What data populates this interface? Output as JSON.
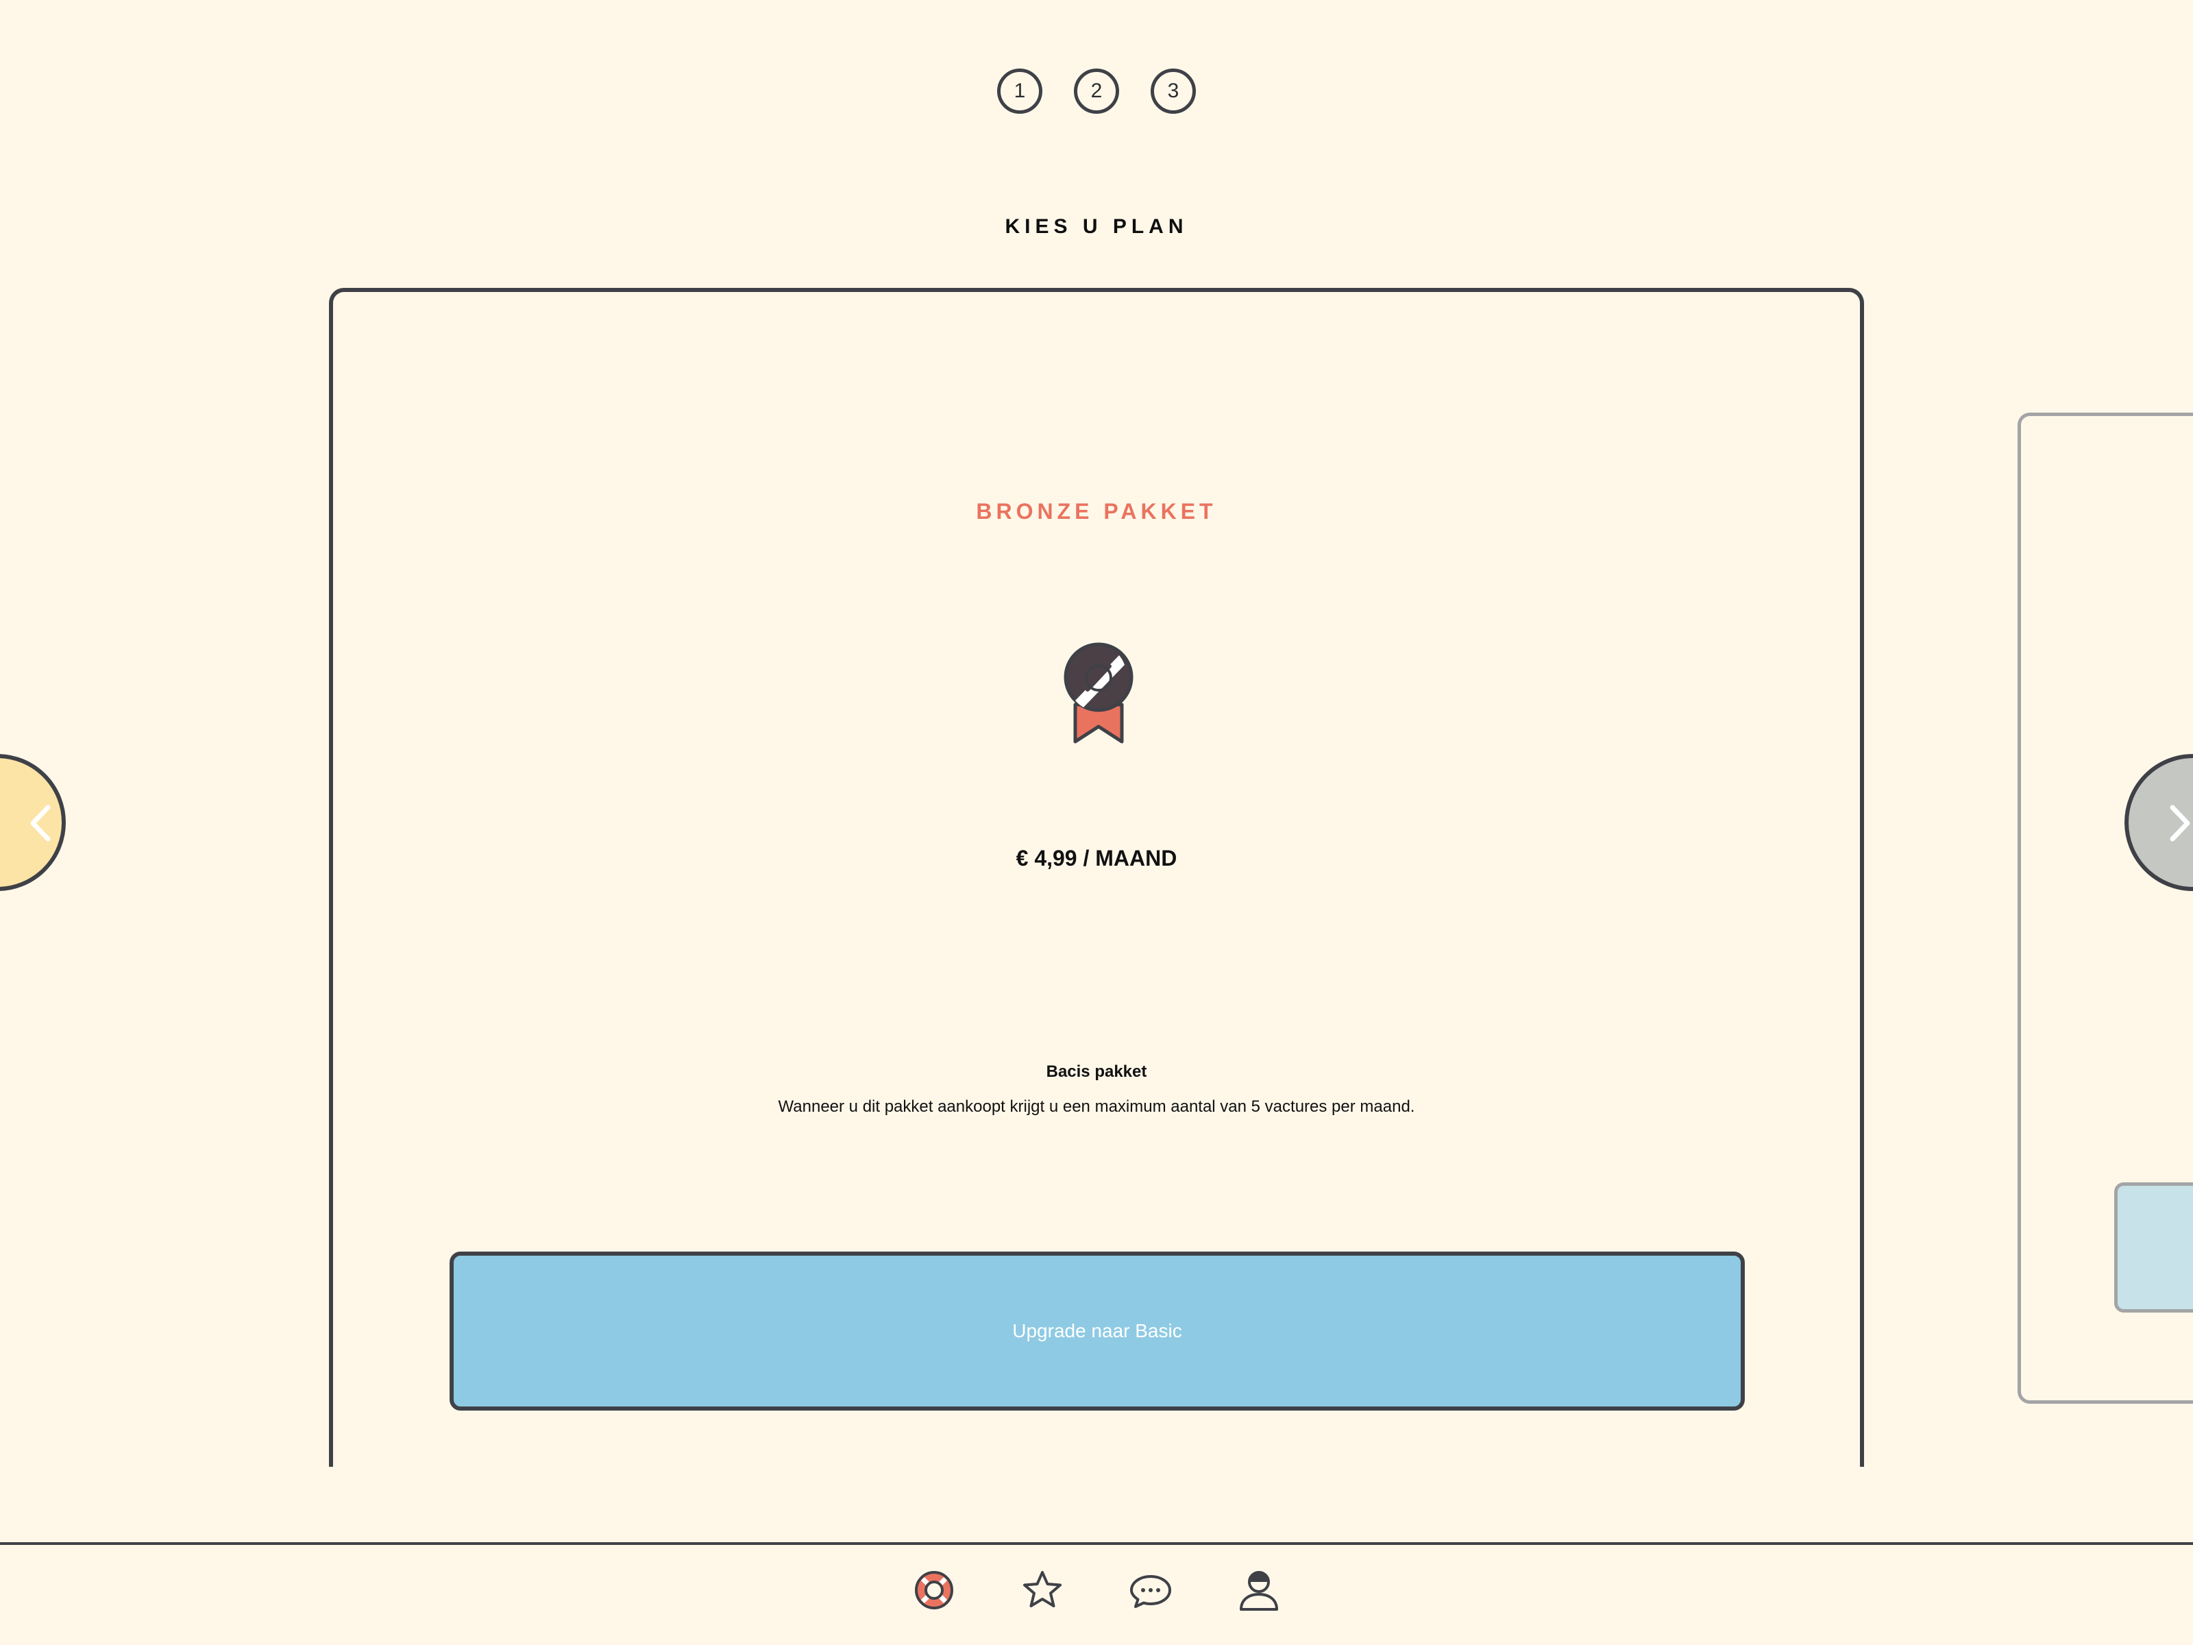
{
  "steps": [
    "1",
    "2",
    "3"
  ],
  "page_title": "KIES U PLAN",
  "plan": {
    "name": "BRONZE PAKKET",
    "icon": "medal-icon",
    "price": "€ 4,99 / MAAND",
    "desc_title": "Bacis pakket",
    "desc_text": "Wanneer u dit pakket aankoopt krijgt u een maximum aantal van 5 vactures per maand.",
    "button_label": "Upgrade naar Basic"
  },
  "navigation": {
    "prev_icon": "chevron-left-icon",
    "next_icon": "chevron-right-icon"
  },
  "bottom_nav": {
    "items": [
      "lifebuoy-icon",
      "star-icon",
      "chat-icon",
      "user-icon"
    ]
  },
  "colors": {
    "background": "#fff8e9",
    "border": "#3f4147",
    "plan_name": "#ea735f",
    "button": "#8ecae3",
    "prev_arrow": "#fbe4a6",
    "next_arrow": "#c5c7c3"
  }
}
